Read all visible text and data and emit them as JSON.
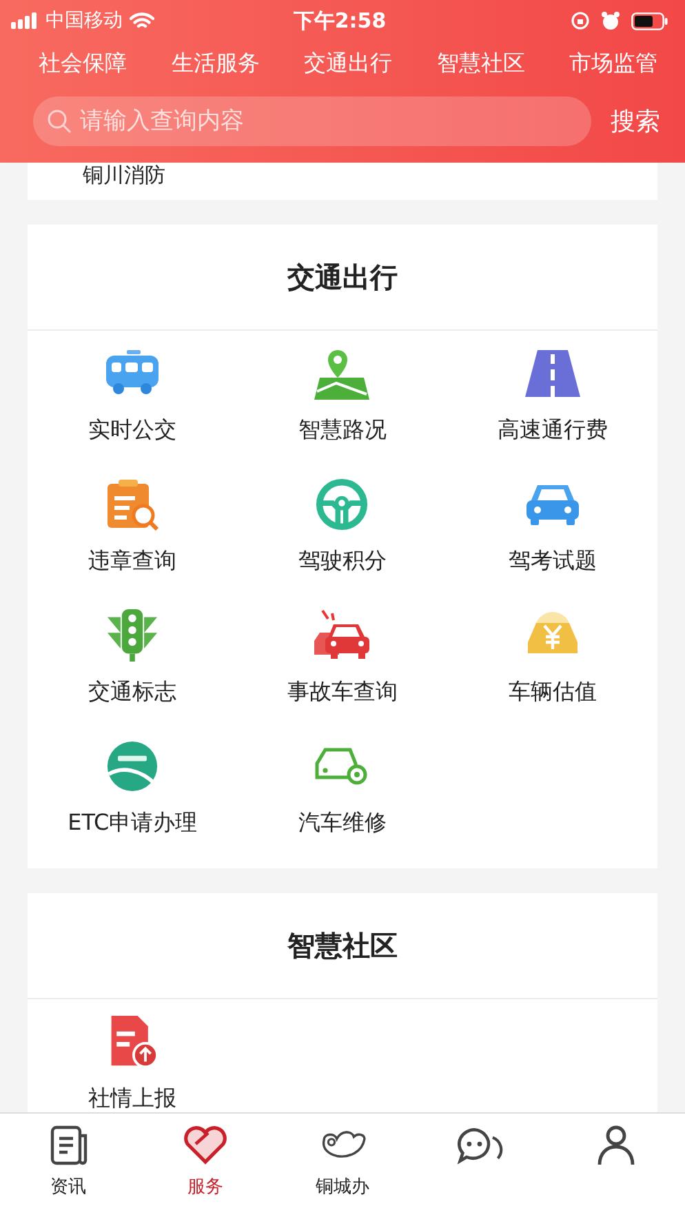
{
  "status_bar": {
    "carrier": "中国移动",
    "time": "下午2:58"
  },
  "category_nav": [
    {
      "label": "社会保障"
    },
    {
      "label": "生活服务"
    },
    {
      "label": "交通出行"
    },
    {
      "label": "智慧社区"
    },
    {
      "label": "市场监管"
    }
  ],
  "search": {
    "placeholder": "请输入查询内容",
    "button": "搜索"
  },
  "partial_section": {
    "items": [
      {
        "label": "铜川消防"
      }
    ]
  },
  "sections": [
    {
      "title": "交通出行",
      "items": [
        {
          "label": "实时公交",
          "kind": "bus"
        },
        {
          "label": "智慧路况",
          "kind": "map"
        },
        {
          "label": "高速通行费",
          "kind": "road"
        },
        {
          "label": "违章查询",
          "kind": "clipboard"
        },
        {
          "label": "驾驶积分",
          "kind": "wheel"
        },
        {
          "label": "驾考试题",
          "kind": "car"
        },
        {
          "label": "交通标志",
          "kind": "light"
        },
        {
          "label": "事故车查询",
          "kind": "crash"
        },
        {
          "label": "车辆估值",
          "kind": "coin"
        },
        {
          "label": "ETC申请办理",
          "kind": "etc"
        },
        {
          "label": "汽车维修",
          "kind": "repair"
        }
      ]
    },
    {
      "title": "智慧社区",
      "items": [
        {
          "label": "社情上报",
          "kind": "report"
        }
      ]
    }
  ],
  "tab_bar": [
    {
      "label": "资讯",
      "kind": "news",
      "selected": false
    },
    {
      "label": "服务",
      "kind": "heart",
      "selected": true
    },
    {
      "label": "铜城办",
      "kind": "cloud",
      "selected": false
    },
    {
      "kind": "chat",
      "selected": false
    },
    {
      "kind": "person",
      "selected": false
    }
  ]
}
